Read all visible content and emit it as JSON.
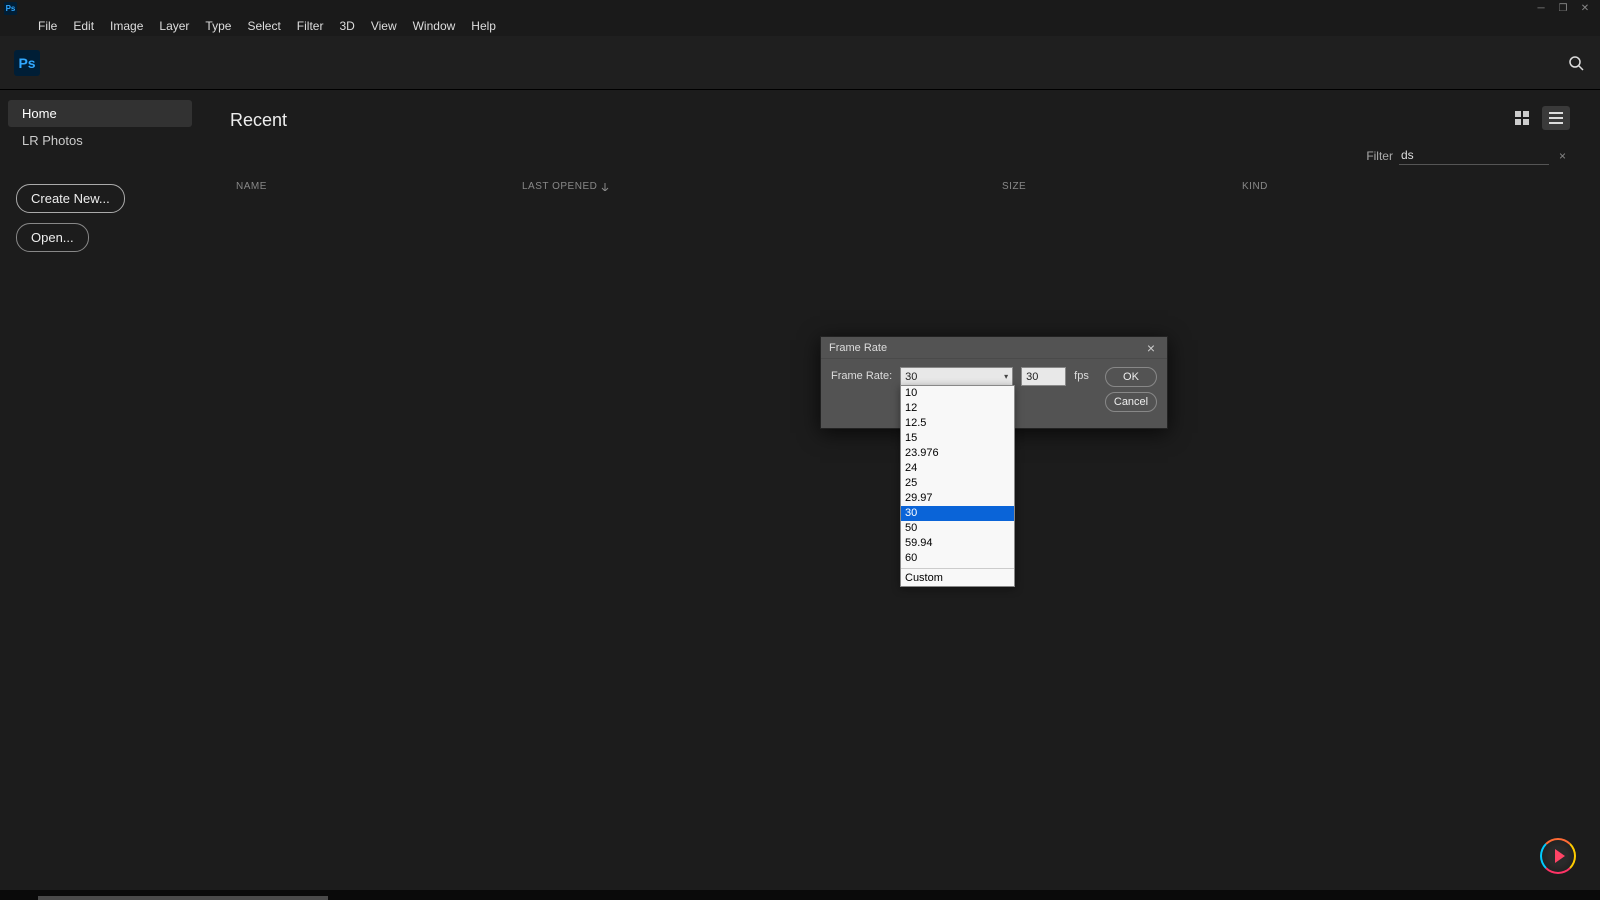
{
  "titlebar": {
    "logo": "Ps"
  },
  "menu": [
    "File",
    "Edit",
    "Image",
    "Layer",
    "Type",
    "Select",
    "Filter",
    "3D",
    "View",
    "Window",
    "Help"
  ],
  "subheader": {
    "logo": "Ps"
  },
  "sidebar": {
    "nav": [
      {
        "label": "Home",
        "active": true
      },
      {
        "label": "LR Photos",
        "active": false
      }
    ],
    "create": "Create New...",
    "open": "Open..."
  },
  "content": {
    "heading": "Recent",
    "filter_label": "Filter",
    "filter_value": "ds",
    "cols": {
      "name": "NAME",
      "last": "LAST OPENED",
      "size": "SIZE",
      "kind": "KIND"
    }
  },
  "dialog": {
    "title": "Frame Rate",
    "label": "Frame Rate:",
    "combo_value": "30",
    "num_value": "30",
    "fps": "fps",
    "ok": "OK",
    "cancel": "Cancel"
  },
  "dropdown": {
    "items": [
      "10",
      "12",
      "12.5",
      "15",
      "23.976",
      "24",
      "25",
      "29.97",
      "30",
      "50",
      "59.94",
      "60"
    ],
    "selected": "30",
    "custom": "Custom"
  }
}
